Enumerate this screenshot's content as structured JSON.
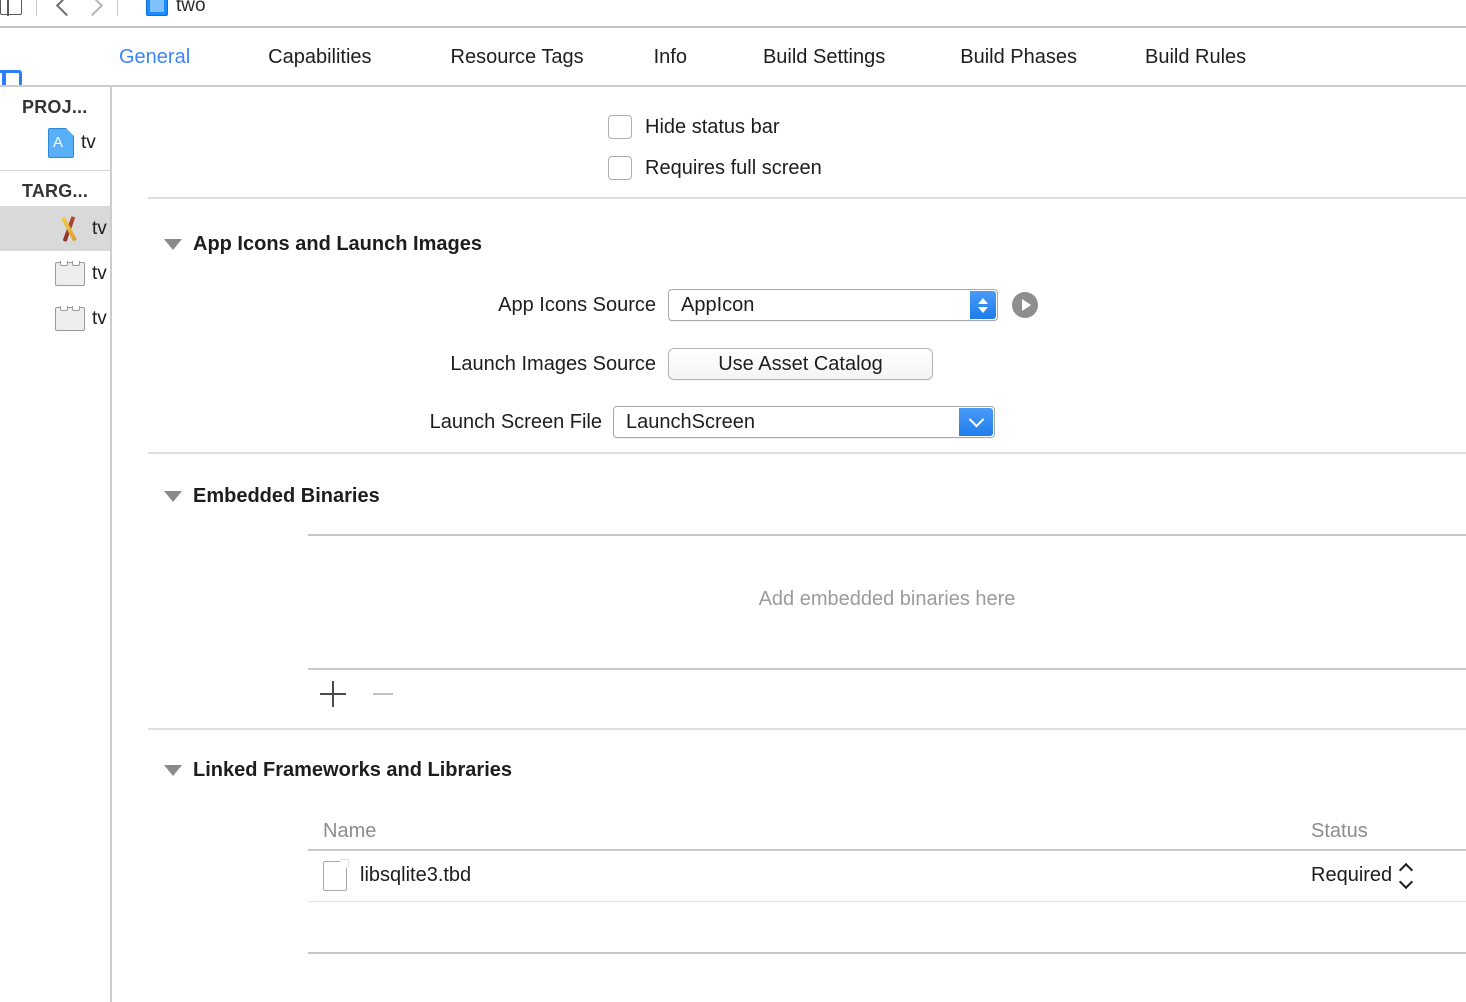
{
  "toolbar": {
    "editor_icon": "editor-layout-icon",
    "back_icon": "chevron-back-icon",
    "forward_icon": "chevron-forward-icon",
    "project_icon": "project-file-icon",
    "breadcrumb": "two"
  },
  "panel_toggle": {
    "icon": "navigator-panel-toggle-icon"
  },
  "tabs": [
    {
      "label": "General",
      "active": true
    },
    {
      "label": "Capabilities",
      "active": false
    },
    {
      "label": "Resource Tags",
      "active": false
    },
    {
      "label": "Info",
      "active": false
    },
    {
      "label": "Build Settings",
      "active": false
    },
    {
      "label": "Build Phases",
      "active": false
    },
    {
      "label": "Build Rules",
      "active": false
    }
  ],
  "sidebar": {
    "project_header": "PROJ...",
    "targets_header": "TARG...",
    "project_items": [
      {
        "label": "tv",
        "icon": "project-file-icon",
        "selected": false
      }
    ],
    "target_items": [
      {
        "label": "tv",
        "icon": "app-target-icon",
        "selected": true
      },
      {
        "label": "tv",
        "icon": "test-bundle-icon",
        "selected": false
      },
      {
        "label": "tv",
        "icon": "test-bundle-icon",
        "selected": false
      }
    ]
  },
  "deployment": {
    "checkboxes": [
      {
        "label": "Hide status bar",
        "checked": false
      },
      {
        "label": "Requires full screen",
        "checked": false
      }
    ]
  },
  "app_icons_section": {
    "title": "App Icons and Launch Images",
    "expanded": true,
    "fields": {
      "app_icons_source_label": "App Icons Source",
      "app_icons_source_value": "AppIcon",
      "app_icons_goto_icon": "arrow-right-circle-icon",
      "launch_images_source_label": "Launch Images Source",
      "launch_images_source_button": "Use Asset Catalog",
      "launch_screen_file_label": "Launch Screen File",
      "launch_screen_file_value": "LaunchScreen"
    }
  },
  "embedded_binaries_section": {
    "title": "Embedded Binaries",
    "expanded": true,
    "empty_message": "Add embedded binaries here",
    "add_icon": "plus-icon",
    "remove_icon": "minus-icon"
  },
  "linked_frameworks_section": {
    "title": "Linked Frameworks and Libraries",
    "expanded": true,
    "columns": [
      "Name",
      "Status"
    ],
    "rows": [
      {
        "name": "libsqlite3.tbd",
        "icon": "document-icon",
        "status": "Required"
      }
    ]
  },
  "colors": {
    "accent_blue": "#3b86f7",
    "control_blue": "#1f7ceb",
    "text": "#1d1d1d",
    "muted_text": "#8c8c8c",
    "placeholder": "#9b9b9b",
    "selected_row": "#d9d9d9"
  }
}
